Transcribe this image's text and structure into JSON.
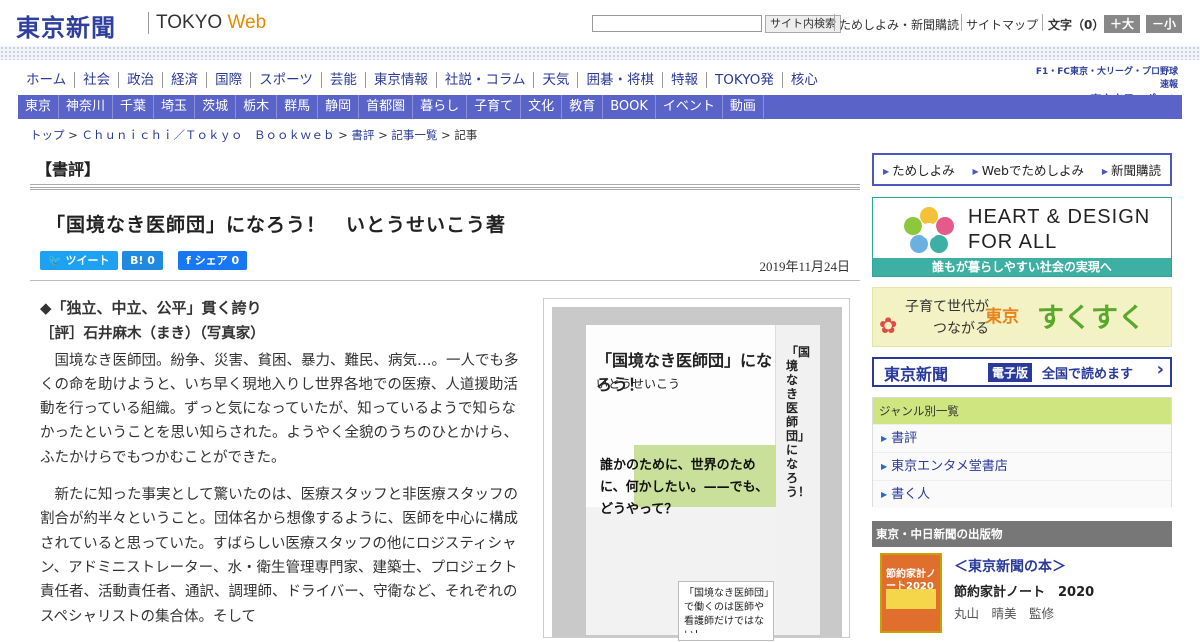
{
  "header": {
    "logo": "東京新聞",
    "site_a": "TOKYO",
    "site_b": "Web",
    "search_button": "サイト内検索",
    "link_trial": "ためしよみ・新聞購読",
    "link_sitemap": "サイトマップ",
    "font_label": "文字（0）",
    "font_large": "＋大",
    "font_small": "－小"
  },
  "nav_main": [
    "ホーム",
    "社会",
    "政治",
    "経済",
    "国際",
    "スポーツ",
    "芸能",
    "東京情報",
    "社説・コラム",
    "天気",
    "囲碁・将棋",
    "特報",
    "TOKYO発",
    "核心"
  ],
  "chunichi": {
    "line1": "F1・FC東京・大リーグ・プロ野球速報",
    "line2": "▶東京中日スポーツ"
  },
  "nav_region": [
    "東京",
    "神奈川",
    "千葉",
    "埼玉",
    "茨城",
    "栃木",
    "群馬",
    "静岡",
    "首都圏",
    "暮らし",
    "子育て",
    "文化",
    "教育",
    "BOOK",
    "イベント",
    "動画"
  ],
  "breadcrumb": {
    "top": "トップ",
    "bookweb": "Ｃｈｕｎｉｃｈｉ／Ｔｏｋｙｏ　Ｂｏｏｋｗｅｂ",
    "review": "書評",
    "list": "記事一覧",
    "current": "記事",
    "sep": ">"
  },
  "section_title": "【書評】",
  "article": {
    "headline": "「国境なき医師団」になろう！　いとうせいこう著",
    "tweet": "ツイート",
    "hatena": "B! 0",
    "share": "シェア 0",
    "date": "2019年11月24日",
    "subhead": "◆「独立、中立、公平」貫く誇り",
    "reviewer": "［評］石井麻木（まき）（写真家）",
    "p1": "国境なき医師団。紛争、災害、貧困、暴力、難民、病気…。一人でも多くの命を助けようと、いち早く現地入りし世界各地での医療、人道援助活動を行っている組織。ずっと気になっていたが、知っているようで知らなかったということを思い知らされた。ようやく全貌のうちのひとかけら、ふたかけらでもつかむことができた。",
    "p2": "新たに知った事実として驚いたのは、医療スタッフと非医療スタッフの割合が約半々ということ。団体名から想像するように、医師を中心に構成されていると思っていた。すばらしい医療スタッフの他にロジスティシャン、アドミニストレーター、水・衛生管理専門家、建築士、プロジェクト責任者、活動責任者、通訳、調理師、ドライバー、守衛など、それぞれのスペシャリストの集合体。そして"
  },
  "book_cover": {
    "title": "「国境なき医師団」になろう！",
    "author": "いとうせいこう",
    "catch": "誰かのために、世界のために、何かしたい。——でも、どうやって？",
    "band": "「国境なき医師団」で働くのは医師や看護師だけではない！",
    "spine": "「国境なき医師団」になろう！"
  },
  "sidebar": {
    "menu": [
      "ためしよみ",
      "Webでためしよみ",
      "新聞購読"
    ],
    "heart_line1": "HEART & DESIGN",
    "heart_line2": "FOR ALL",
    "heart_caption": "誰もが暮らしやすい社会の実現へ",
    "suku_a": "子育て世代が",
    "suku_b": "つながる",
    "suku_c": "東京",
    "suku_d": "すくすく",
    "denshi_a": "東京新聞",
    "denshi_b": "電子版",
    "denshi_c": "全国で読めます",
    "genre_header": "ジャンル別一覧",
    "genres": [
      "書評",
      "東京エンタメ堂書店",
      "書く人"
    ],
    "pub_header": "東京・中日新聞の出版物",
    "pub_title": "＜東京新聞の本＞",
    "pub_book": "節約家計ノート　2020",
    "pub_author": "丸山　晴美　監修",
    "pub_cover": "節約家計ノート2020"
  },
  "colors": {
    "brand": "#2f3f9e",
    "nav_bar": "#5a63c8",
    "accent_green": "#cfe57f"
  }
}
